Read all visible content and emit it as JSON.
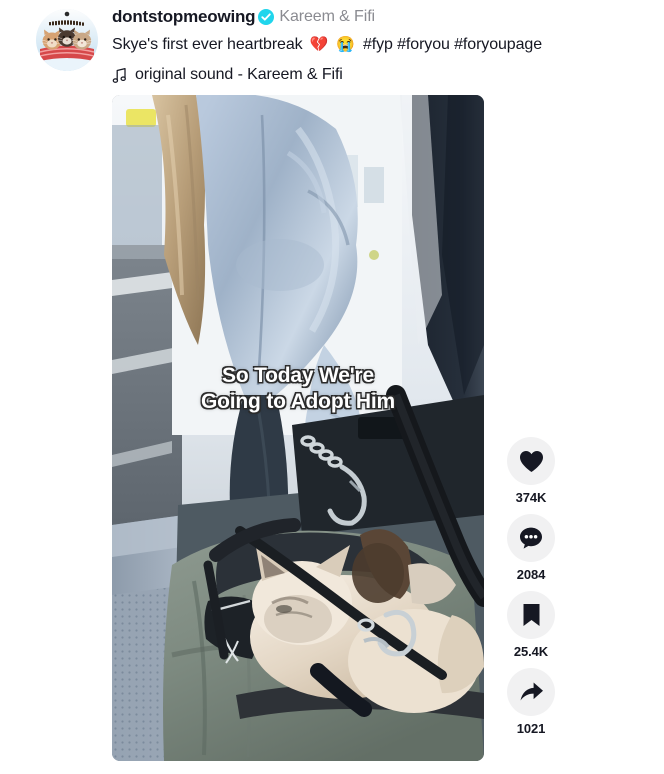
{
  "post": {
    "author": {
      "username": "dontstopmeowing",
      "nickname": "Kareem & Fifi",
      "verified_badge": "verified-check-icon",
      "avatar_alt": "three cats wrapped in a red blanket"
    },
    "caption": {
      "text": "Skye's first ever heartbreak",
      "emoji_1": "💔",
      "emoji_2": "😭",
      "hashtags": "#fyp #foryou #foryoupage"
    },
    "music": {
      "icon": "music-note-icon",
      "label": "original sound - Kareem & Fifi"
    },
    "video": {
      "overlay_line_1": "So Today We're",
      "overlay_line_2": "Going to Adopt Him"
    },
    "actions": [
      {
        "icon": "heart-icon",
        "name": "like",
        "count": "374K"
      },
      {
        "icon": "comment-icon",
        "name": "comment",
        "count": "2084"
      },
      {
        "icon": "bookmark-icon",
        "name": "save",
        "count": "25.4K"
      },
      {
        "icon": "share-icon",
        "name": "share",
        "count": "1021"
      }
    ]
  },
  "colors": {
    "text": "#161823",
    "muted": "#8a8b91",
    "verified": "#20d5ec",
    "bubble_bg": "#f1f1f2",
    "page_bg": "#ffffff"
  }
}
